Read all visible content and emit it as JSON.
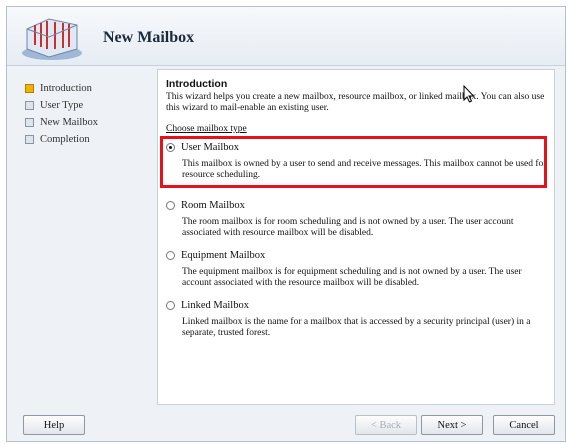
{
  "window": {
    "title": "New Mailbox"
  },
  "nav": {
    "items": [
      {
        "label": "Introduction",
        "active": true
      },
      {
        "label": "User Type",
        "active": false
      },
      {
        "label": "New Mailbox",
        "active": false
      },
      {
        "label": "Completion",
        "active": false
      }
    ]
  },
  "content": {
    "section_title": "Introduction",
    "intro": "This wizard helps you create a new mailbox, resource mailbox, or linked mailbox. You can also use this wizard to mail-enable an existing user.",
    "choose_label": "Choose mailbox type",
    "options": [
      {
        "label": "User Mailbox",
        "checked": true,
        "description": "This mailbox is owned by a user to send and receive messages. This mailbox cannot be used for resource scheduling."
      },
      {
        "label": "Room Mailbox",
        "checked": false,
        "description": "The room mailbox is for room scheduling and is not owned by a user. The user account associated with resource mailbox will be disabled."
      },
      {
        "label": "Equipment Mailbox",
        "checked": false,
        "description": "The equipment mailbox is for equipment scheduling and is not owned by a user. The user account associated with the resource mailbox will be disabled."
      },
      {
        "label": "Linked Mailbox",
        "checked": false,
        "description": "Linked mailbox is the name for a mailbox that is accessed by a security principal (user) in a separate, trusted forest."
      }
    ]
  },
  "footer": {
    "help": "Help",
    "back": "< Back",
    "next": "Next >",
    "cancel": "Cancel"
  },
  "colors": {
    "highlight": "#e3121b",
    "active_nav": "#f0b400"
  }
}
